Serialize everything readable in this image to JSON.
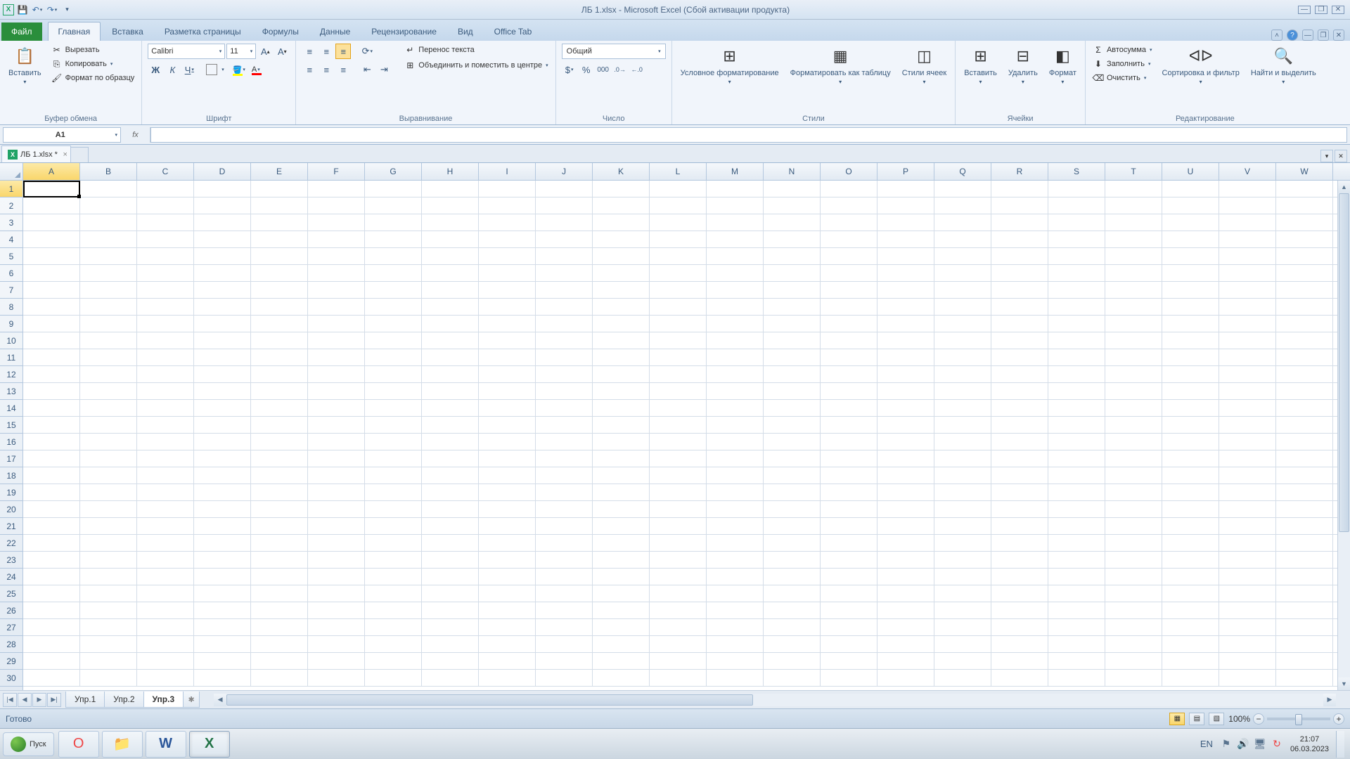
{
  "title": "ЛБ 1.xlsx - Microsoft Excel (Сбой активации продукта)",
  "tabs": {
    "file": "Файл",
    "home": "Главная",
    "insert": "Вставка",
    "layout": "Разметка страницы",
    "formulas": "Формулы",
    "data": "Данные",
    "review": "Рецензирование",
    "view": "Вид",
    "office": "Office Tab"
  },
  "clipboard": {
    "paste": "Вставить",
    "cut": "Вырезать",
    "copy": "Копировать",
    "fmt": "Формат по образцу",
    "label": "Буфер обмена"
  },
  "font": {
    "name": "Calibri",
    "size": "11",
    "label": "Шрифт"
  },
  "align": {
    "wrap": "Перенос текста",
    "merge": "Объединить и поместить в центре",
    "label": "Выравнивание"
  },
  "number": {
    "format": "Общий",
    "label": "Число"
  },
  "styles": {
    "cond": "Условное форматирование",
    "table": "Форматировать как таблицу",
    "cell": "Стили ячеек",
    "label": "Стили"
  },
  "cells": {
    "insert": "Вставить",
    "delete": "Удалить",
    "format": "Формат",
    "label": "Ячейки"
  },
  "editing": {
    "sum": "Автосумма",
    "fill": "Заполнить",
    "clear": "Очистить",
    "sort": "Сортировка и фильтр",
    "find": "Найти и выделить",
    "label": "Редактирование"
  },
  "namebox": "A1",
  "doctab": "ЛБ 1.xlsx *",
  "cols": [
    "A",
    "B",
    "C",
    "D",
    "E",
    "F",
    "G",
    "H",
    "I",
    "J",
    "K",
    "L",
    "M",
    "N",
    "O",
    "P",
    "Q",
    "R",
    "S",
    "T",
    "U",
    "V",
    "W"
  ],
  "rows": 30,
  "sheets": {
    "s1": "Упр.1",
    "s2": "Упр.2",
    "s3": "Упр.3"
  },
  "status": "Готово",
  "zoom": "100%",
  "start": "Пуск",
  "lang": "EN",
  "time": "21:07",
  "date": "06.03.2023"
}
